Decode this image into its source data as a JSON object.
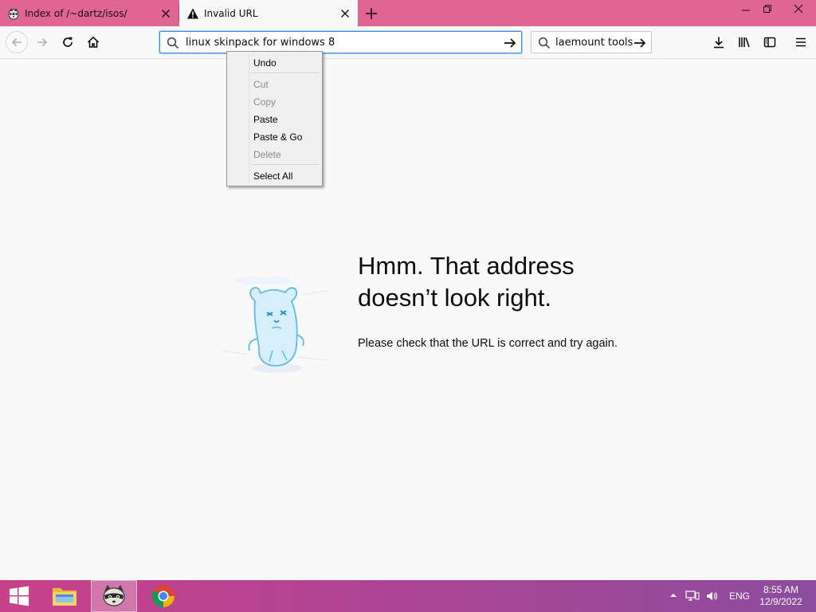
{
  "tabs": [
    {
      "title": "Index of /~dartz/isos/",
      "icon": "raccoon-icon",
      "active": false
    },
    {
      "title": "Invalid URL",
      "icon": "warning-icon",
      "active": true
    }
  ],
  "navbar": {
    "url_value": "linux skinpack for windows 8",
    "search_value": "laemount tools"
  },
  "context_menu": {
    "undo": "Undo",
    "cut": "Cut",
    "copy": "Copy",
    "paste": "Paste",
    "paste_go": "Paste & Go",
    "delete": "Delete",
    "select_all": "Select All"
  },
  "error": {
    "title_line1": "Hmm. That address",
    "title_line2": "doesn’t look right.",
    "description": "Please check that the URL is correct and try again."
  },
  "taskbar": {
    "language": "ENG",
    "time": "8:55 AM",
    "date": "12/9/2022"
  },
  "colors": {
    "tabstrip": "#e06593",
    "accent_focus": "#3f8fe8",
    "taskbar_start": "#c8428a",
    "taskbar_end": "#8d4c9e"
  }
}
